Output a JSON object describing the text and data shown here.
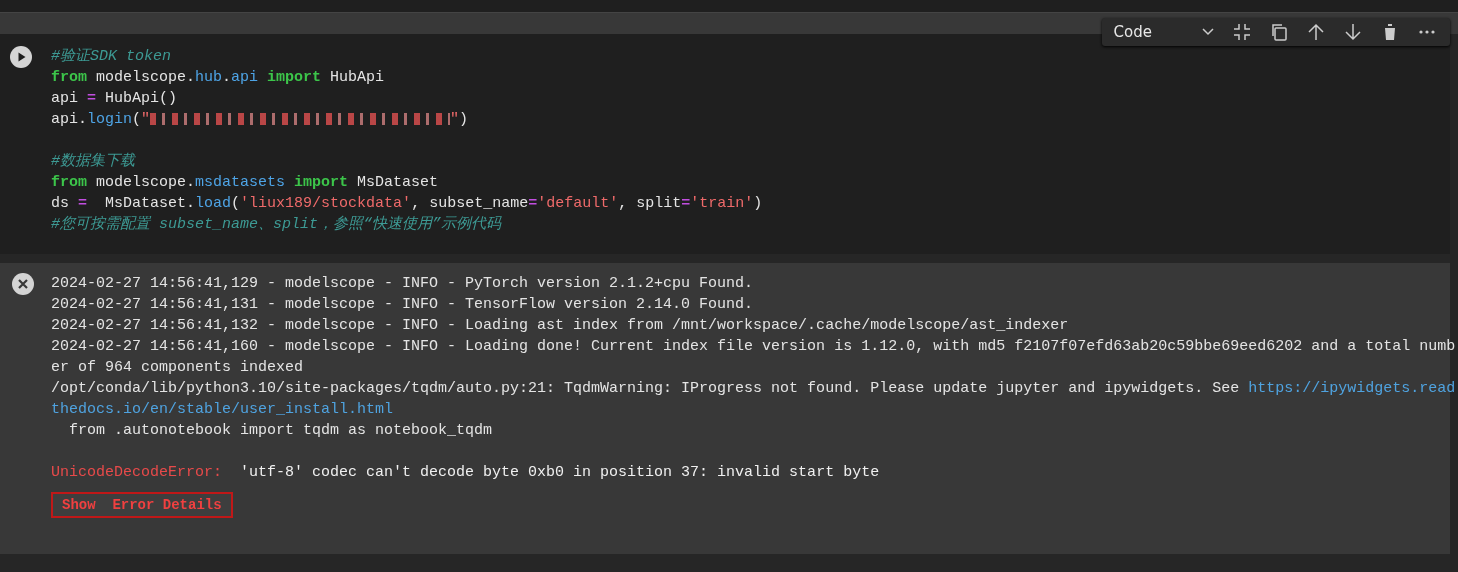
{
  "cell_toolbar": {
    "cell_type": "Code"
  },
  "code_cell": {
    "lines": [
      {
        "segments": [
          {
            "kind": "comment",
            "text": "#验证SDK token"
          }
        ]
      },
      {
        "segments": [
          {
            "kind": "keyword",
            "text": "from"
          },
          {
            "kind": "plain",
            "text": " modelscope."
          },
          {
            "kind": "attr",
            "text": "hub"
          },
          {
            "kind": "plain",
            "text": "."
          },
          {
            "kind": "attr",
            "text": "api"
          },
          {
            "kind": "keyword",
            "text": " import"
          },
          {
            "kind": "plain",
            "text": " HubApi"
          }
        ]
      },
      {
        "segments": [
          {
            "kind": "plain",
            "text": "api "
          },
          {
            "kind": "op",
            "text": "="
          },
          {
            "kind": "plain",
            "text": " HubApi()"
          }
        ]
      },
      {
        "segments": [
          {
            "kind": "plain",
            "text": "api."
          },
          {
            "kind": "attr",
            "text": "login"
          },
          {
            "kind": "plain",
            "text": "("
          },
          {
            "kind": "string",
            "text": "\""
          },
          {
            "kind": "redacted"
          },
          {
            "kind": "string",
            "text": "\""
          },
          {
            "kind": "plain",
            "text": ")"
          }
        ]
      },
      {
        "gap_before": true,
        "segments": [
          {
            "kind": "comment",
            "text": "#数据集下载"
          }
        ]
      },
      {
        "segments": [
          {
            "kind": "keyword",
            "text": "from"
          },
          {
            "kind": "plain",
            "text": " modelscope."
          },
          {
            "kind": "attr",
            "text": "msdatasets"
          },
          {
            "kind": "keyword",
            "text": " import"
          },
          {
            "kind": "plain",
            "text": " MsDataset"
          }
        ]
      },
      {
        "segments": [
          {
            "kind": "plain",
            "text": "ds "
          },
          {
            "kind": "op",
            "text": "="
          },
          {
            "kind": "plain",
            "text": "  MsDataset."
          },
          {
            "kind": "attr",
            "text": "load"
          },
          {
            "kind": "plain",
            "text": "("
          },
          {
            "kind": "string",
            "text": "'liux189/stockdata'"
          },
          {
            "kind": "plain",
            "text": ", subset_name"
          },
          {
            "kind": "op",
            "text": "="
          },
          {
            "kind": "string",
            "text": "'default'"
          },
          {
            "kind": "plain",
            "text": ", split"
          },
          {
            "kind": "op",
            "text": "="
          },
          {
            "kind": "string",
            "text": "'train'"
          },
          {
            "kind": "plain",
            "text": ")"
          }
        ]
      },
      {
        "segments": [
          {
            "kind": "comment",
            "text": "#您可按需配置 subset_name、split，参照“快速使用”示例代码"
          }
        ]
      }
    ]
  },
  "output": {
    "lines": [
      {
        "segments": [
          {
            "kind": "plain",
            "text": "2024-02-27 14:56:41,129 - modelscope - INFO - PyTorch version 2.1.2+cpu Found."
          }
        ]
      },
      {
        "segments": [
          {
            "kind": "plain",
            "text": "2024-02-27 14:56:41,131 - modelscope - INFO - TensorFlow version 2.14.0 Found."
          }
        ]
      },
      {
        "segments": [
          {
            "kind": "plain",
            "text": "2024-02-27 14:56:41,132 - modelscope - INFO - Loading ast index from /mnt/workspace/.cache/modelscope/ast_indexer"
          }
        ]
      },
      {
        "segments": [
          {
            "kind": "plain",
            "text": "2024-02-27 14:56:41,160 - modelscope - INFO - Loading done! Current index file version is 1.12.0, with md5 f2107f07efd63ab20c59bbe69eed6202 and a total numb"
          }
        ]
      },
      {
        "segments": [
          {
            "kind": "plain",
            "text": "er of 964 components indexed"
          }
        ]
      },
      {
        "segments": [
          {
            "kind": "plain",
            "text": "/opt/conda/lib/python3.10/site-packages/tqdm/auto.py:21: TqdmWarning: IProgress not found. Please update jupyter and ipywidgets. See "
          },
          {
            "kind": "link",
            "text": "https://ipywidgets.read"
          }
        ]
      },
      {
        "segments": [
          {
            "kind": "link",
            "text": "thedocs.io/en/stable/user_install.html"
          }
        ]
      },
      {
        "segments": [
          {
            "kind": "plain",
            "text": "  from .autonotebook import tqdm as notebook_tqdm"
          }
        ]
      }
    ],
    "error": {
      "name": "UnicodeDecodeError:",
      "message": "'utf-8' codec can't decode byte 0xb0 in position 37: invalid start byte",
      "button": "Show  Error Details"
    }
  }
}
